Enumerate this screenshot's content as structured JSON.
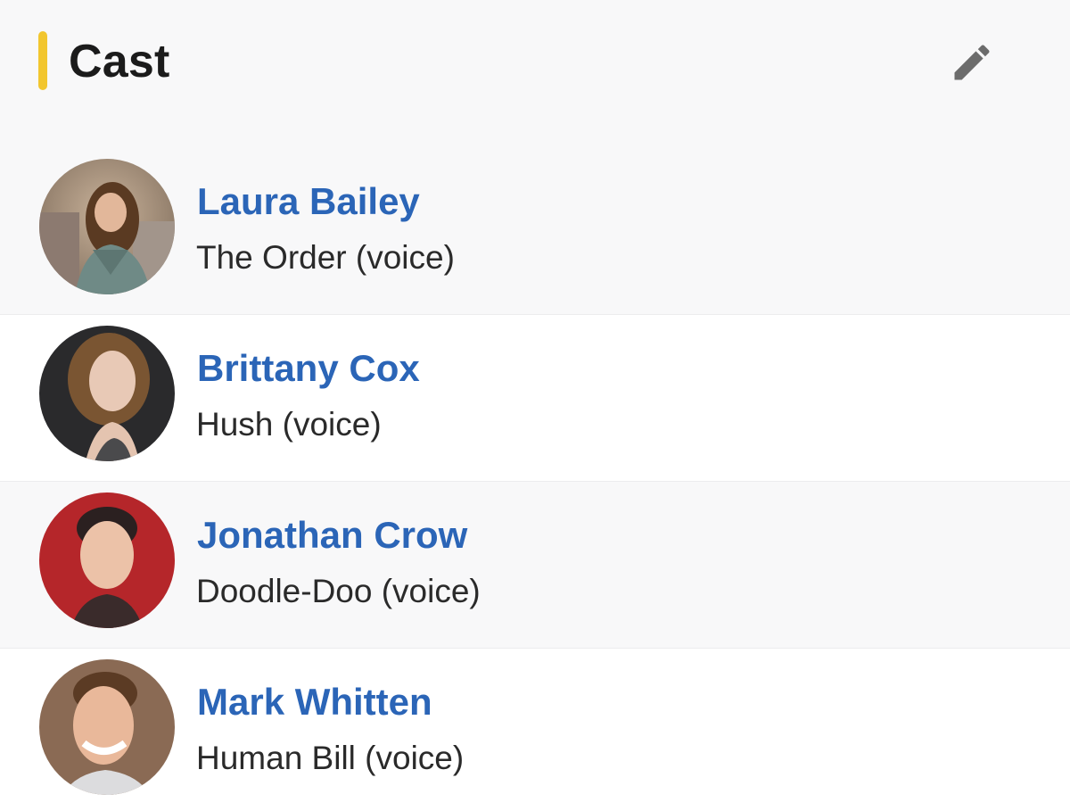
{
  "section": {
    "title": "Cast",
    "accent_color": "#f2c62f",
    "edit_icon": "pencil-icon"
  },
  "cast": [
    {
      "actor": "Laura Bailey",
      "role": "The Order (voice)",
      "avatar": "avatar-photo"
    },
    {
      "actor": "Brittany Cox",
      "role": "Hush (voice)",
      "avatar": "avatar-photo"
    },
    {
      "actor": "Jonathan Crow",
      "role": "Doodle-Doo (voice)",
      "avatar": "avatar-photo"
    },
    {
      "actor": "Mark Whitten",
      "role": "Human Bill (voice)",
      "avatar": "avatar-photo"
    }
  ],
  "colors": {
    "link": "#2b65b7",
    "text": "#2a2a2a",
    "background": "#f8f8f9"
  }
}
